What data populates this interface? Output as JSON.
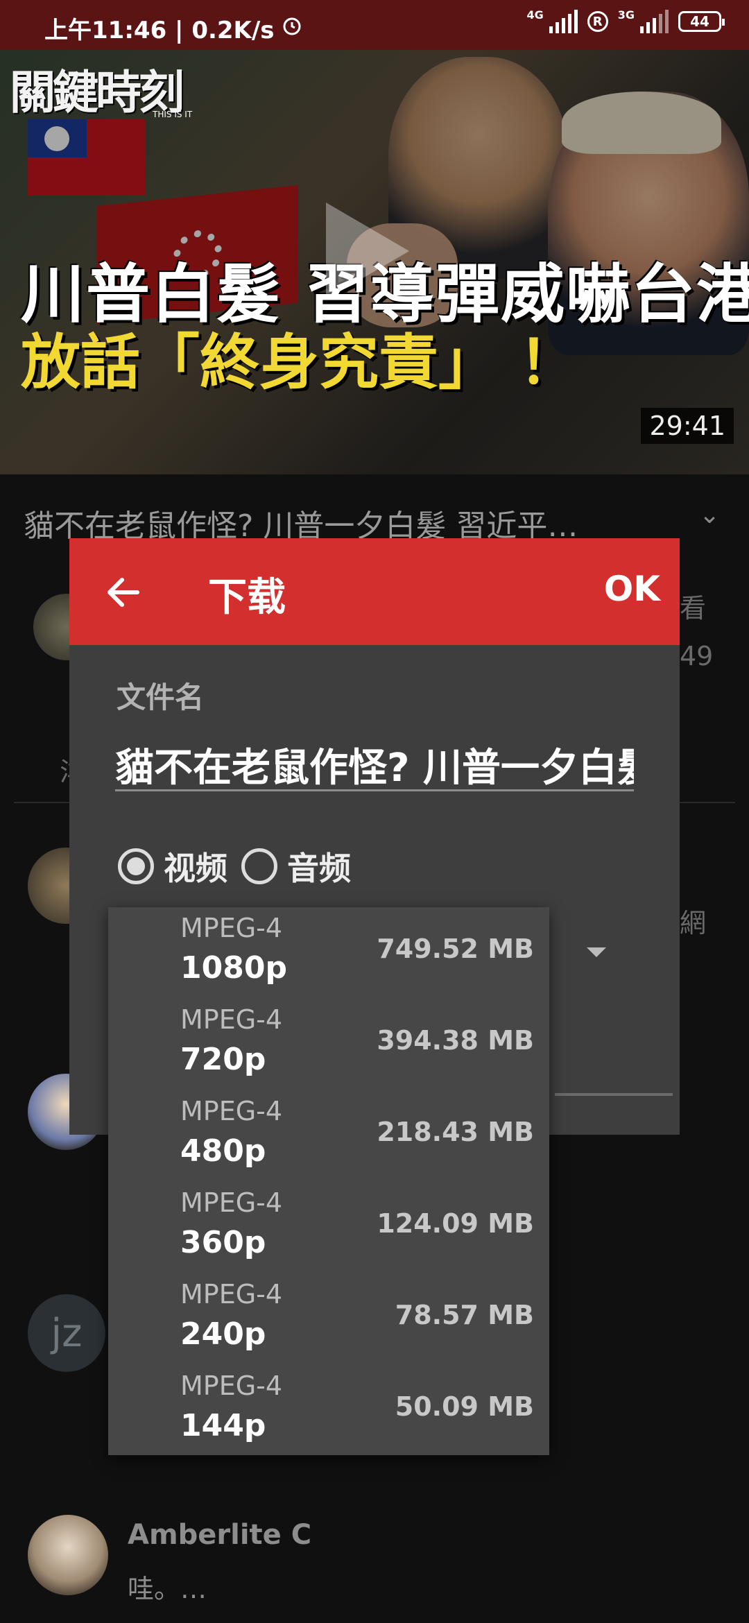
{
  "status_bar": {
    "time_speed": "上午11:46 | 0.2K/s",
    "net1": "4G",
    "net2": "3G",
    "roaming": "R",
    "battery": "44"
  },
  "video": {
    "logo_text": "關鍵時刻",
    "logo_sub": "THIS IS IT",
    "headline_line1": "川普白髮 習導彈威嚇台港",
    "headline_line2": "放話「終身究責」 ！",
    "duration": "29:41",
    "title": "貓不在老鼠作怪? 川普一夕白髮 習近平…"
  },
  "background": {
    "peek_right_1": "看",
    "peek_right_2": "49",
    "peek_right_3": "網",
    "peek_left": "洋",
    "avatar_jz": "jz",
    "commenter": "Amberlite C",
    "comment": "哇。…"
  },
  "dialog": {
    "title": "下载",
    "ok_label": "OK",
    "filename_label": "文件名",
    "filename_value": "貓不在老鼠作怪? 川普一夕白髮 習近平",
    "radio_video": "视频",
    "radio_audio": "音频",
    "selected": "video"
  },
  "dropdown": {
    "options": [
      {
        "format": "MPEG-4",
        "resolution": "1080p",
        "size": "749.52 MB"
      },
      {
        "format": "MPEG-4",
        "resolution": "720p",
        "size": "394.38 MB"
      },
      {
        "format": "MPEG-4",
        "resolution": "480p",
        "size": "218.43 MB"
      },
      {
        "format": "MPEG-4",
        "resolution": "360p",
        "size": "124.09 MB"
      },
      {
        "format": "MPEG-4",
        "resolution": "240p",
        "size": "78.57 MB"
      },
      {
        "format": "MPEG-4",
        "resolution": "144p",
        "size": "50.09 MB"
      }
    ]
  },
  "colors": {
    "status_bar": "#5a1414",
    "dialog_header": "#d32f2f",
    "dialog_body": "#3e3e3e",
    "dropdown_bg": "#474747",
    "headline_yellow": "#f1d833"
  }
}
